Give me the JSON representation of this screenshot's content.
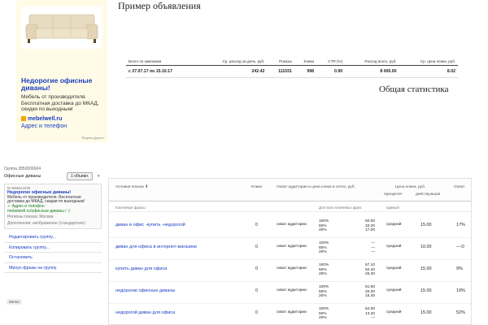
{
  "ad": {
    "title": "Недорогие офисные диваны!",
    "description": "Мебель от производителя. Бесплатная доставка до МКАД, скидки по выходным!",
    "domain": "mebelwell.ru",
    "contact": "Адрес и телефон",
    "source": "Яндекс.Директ"
  },
  "example_title": "Пример объявления",
  "stats": {
    "headers": [
      "Всего по кампании",
      "Ср. расход за день, руб.",
      "Показы",
      "Клики",
      "CTR (%)",
      "Расход всего, руб.",
      "Ср. цена клика, руб."
    ],
    "row": [
      "с 27.07.17 по 15.10.17",
      "242.42",
      "111031",
      "998",
      "0.90",
      "8 000.00",
      "8.02"
    ],
    "caption": "Общая статистика"
  },
  "group": {
    "id": "Группа 2850006604",
    "name": "Офисные диваны",
    "ads_count": "1 объявл.",
    "mini_ad": {
      "id": "М-4855514405",
      "title": "Недорогие офисные диваны!",
      "text": "Мебель от производителя. Бесплатная доставка до МКАД, скидки по выходным!",
      "contact": "✓ Адрес и телефон",
      "domain": "mebelwell.ru/офисные-диваны / ⇩",
      "regions": "Регионы показа: Москва",
      "extras": "Дополнения: изображение (стандартное)"
    },
    "actions": [
      "Редактировать группу...",
      "Копировать группу...",
      "Остановить",
      "Минус-фразы на группу"
    ],
    "labels": "Метки"
  },
  "keywords": {
    "headers": {
      "phrase": "Условия показа ⬆",
      "clicks": "Клики",
      "reach": "Охват аудитории и цена клика в сетях, руб.",
      "price": "Цена клика, руб.",
      "ctr": "Охват"
    },
    "subheaders": {
      "group": "Ключевые фразы",
      "all_phrases": "Для всех ключевых фраз",
      "single": "единый",
      "priority": "приоритет",
      "current": "действующая"
    },
    "rows": [
      {
        "phrase": "диван в офис -купить -недорогой",
        "clicks": "0",
        "reach": "охват аудитории",
        "pcts": [
          "100%",
          "50%",
          "20%"
        ],
        "bids": [
          "50.00",
          "33.20",
          "17.00"
        ],
        "priority": "средний",
        "price": "15.00",
        "ctr": "17%"
      },
      {
        "phrase": "диван для офиса в интернет-магазине",
        "clicks": "0",
        "reach": "охват аудитории",
        "pcts": [
          "100%",
          "50%",
          "20%"
        ],
        "bids": [
          "—",
          "—",
          "—"
        ],
        "priority": "средний",
        "price": "10.00",
        "ctr": "—"
      },
      {
        "phrase": "купить диван для офиса",
        "clicks": "0",
        "reach": "охват аудитории",
        "pcts": [
          "100%",
          "50%",
          "20%"
        ],
        "bids": [
          "67.10",
          "52.40",
          "26.30"
        ],
        "priority": "средний",
        "price": "15.00",
        "ctr": "9%"
      },
      {
        "phrase": "недорогие офисные диваны",
        "clicks": "0",
        "reach": "охват аудитории",
        "pcts": [
          "100%",
          "50%",
          "20%"
        ],
        "bids": [
          "61.60",
          "20.00",
          "15.30"
        ],
        "priority": "средний",
        "price": "15.00",
        "ctr": "19%"
      },
      {
        "phrase": "недорогой диван для офиса",
        "clicks": "0",
        "reach": "охват аудитории",
        "pcts": [
          "100%",
          "50%",
          "20%"
        ],
        "bids": [
          "54.60",
          "13.20",
          "—"
        ],
        "priority": "средний",
        "price": "15.00",
        "ctr": "52%"
      }
    ]
  },
  "colors": {
    "link": "#1a3dc1",
    "green": "#1a7f1a",
    "ad_bg": "#fffbe6"
  },
  "icons": [
    "sofa-image",
    "domain-favicon-icon",
    "help-circle-icon"
  ]
}
